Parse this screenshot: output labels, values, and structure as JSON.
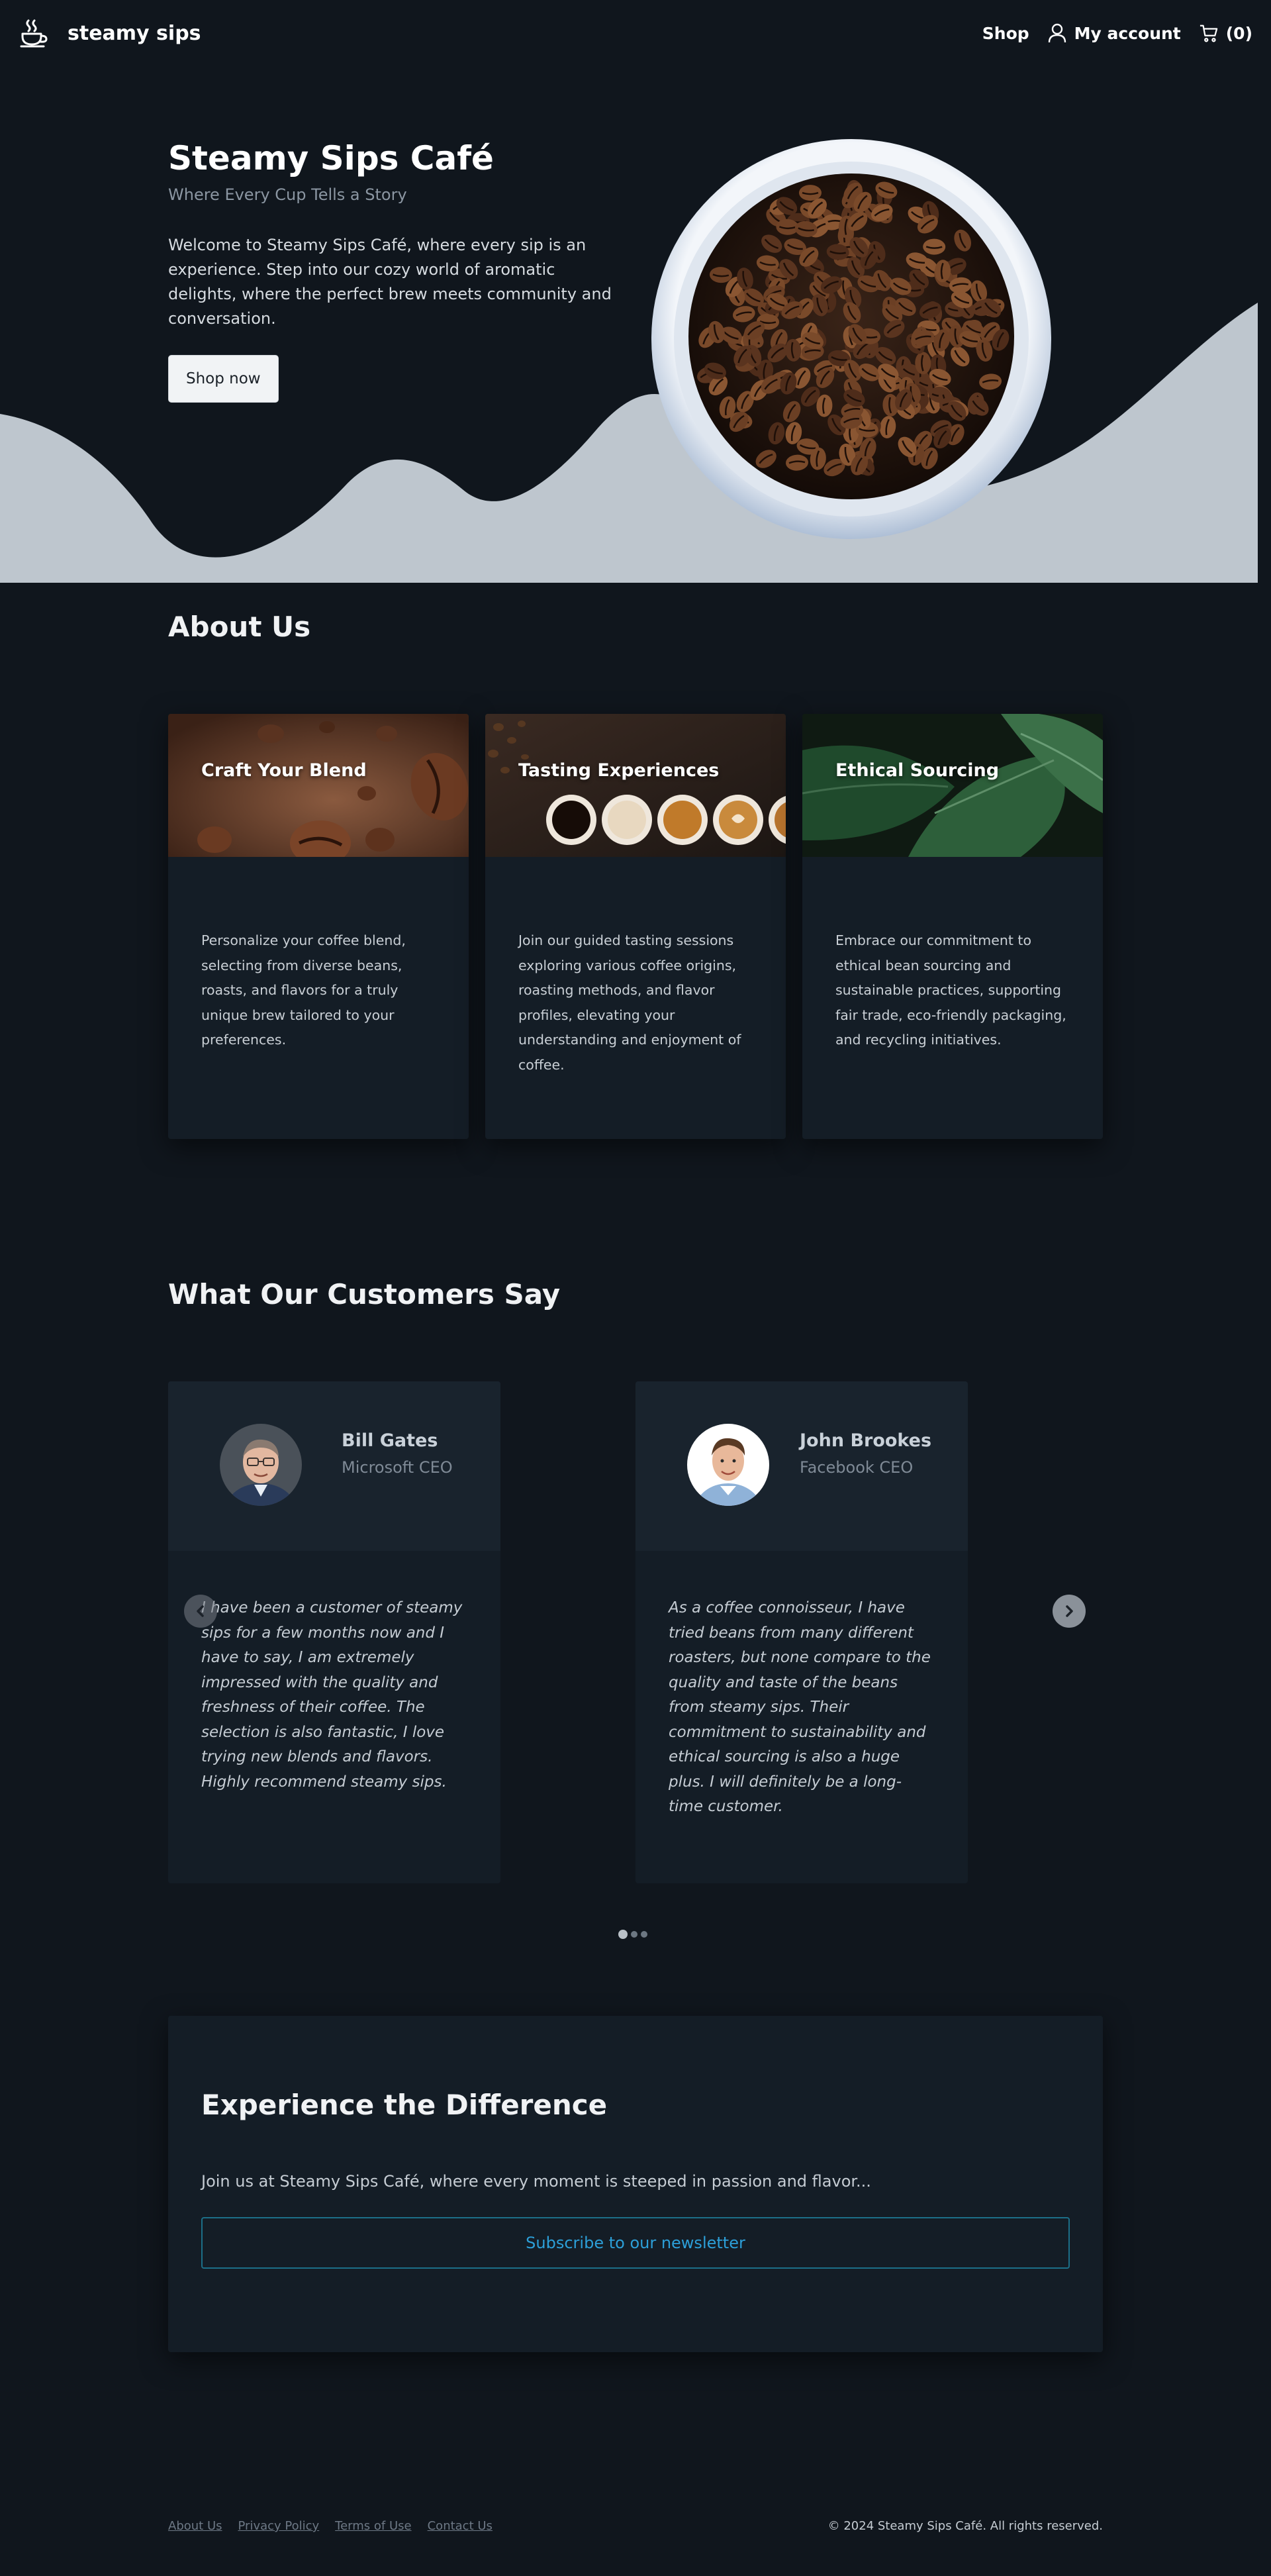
{
  "header": {
    "brand_icon": "coffee-cup-icon",
    "brand": "steamy sips",
    "nav": {
      "shop": "Shop",
      "account": "My account",
      "account_icon": "user-icon",
      "cart_icon": "cart-icon",
      "cart_count": "(0)"
    }
  },
  "hero": {
    "title": "Steamy Sips Café",
    "subtitle": "Where Every Cup Tells a Story",
    "description": "Welcome to Steamy Sips Café, where every sip is an experience. Step into our cozy world of aromatic delights, where the perfect brew meets community and conversation.",
    "cta": "Shop now"
  },
  "about": {
    "title": "About Us",
    "cards": [
      {
        "title": "Craft Your Blend",
        "text": "Personalize your coffee blend, selecting from diverse beans, roasts, and flavors for a truly unique brew tailored to your preferences."
      },
      {
        "title": "Tasting Experiences",
        "text": "Join our guided tasting sessions exploring various coffee origins, roasting methods, and flavor profiles, elevating your understanding and enjoyment of coffee."
      },
      {
        "title": "Ethical Sourcing",
        "text": "Embrace our commitment to ethical bean sourcing and sustainable practices, supporting fair trade, eco-friendly packaging, and recycling initiatives."
      }
    ]
  },
  "testimonials": {
    "title": "What Our Customers Say",
    "items": [
      {
        "name": "Bill Gates",
        "role": "Microsoft CEO",
        "quote": "I have been a customer of steamy sips for a few months now and I have to say, I am extremely impressed with the quality and freshness of their coffee. The selection is also fantastic, I love trying new blends and flavors. Highly recommend steamy sips."
      },
      {
        "name": "John Brookes",
        "role": "Facebook CEO",
        "quote": "As a coffee connoisseur, I have tried beans from many different roasters, but none compare to the quality and taste of the beans from steamy sips. Their commitment to sustainability and ethical sourcing is also a huge plus. I will definitely be a long-time customer."
      }
    ],
    "prev_icon": "chevron-left-icon",
    "next_icon": "chevron-right-icon",
    "active_slide": 1,
    "slide_count": 3
  },
  "newsletter": {
    "title": "Experience the Difference",
    "text": "Join us at Steamy Sips Café, where every moment is steeped in passion and flavor...",
    "button": "Subscribe to our newsletter"
  },
  "footer": {
    "links": [
      "About Us",
      "Privacy Policy",
      "Terms of Use",
      "Contact Us"
    ],
    "copyright": "© 2024 Steamy Sips Café. All rights reserved."
  }
}
